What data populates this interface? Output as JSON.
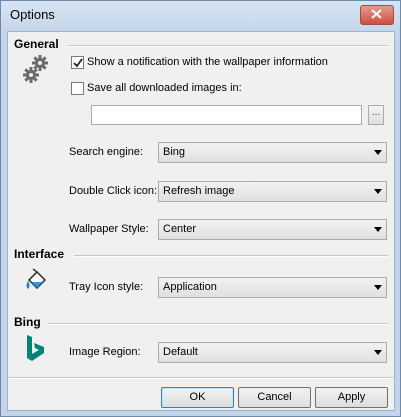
{
  "window": {
    "title": "Options"
  },
  "general": {
    "title": "General",
    "show_notification": {
      "label": "Show a notification with the wallpaper information",
      "checked": true
    },
    "save_images": {
      "label": "Save all downloaded images in:",
      "checked": false
    },
    "save_path": {
      "value": ""
    },
    "browse_label": "...",
    "search_engine": {
      "label": "Search engine:",
      "value": "Bing"
    },
    "double_click": {
      "label": "Double Click icon:",
      "value": "Refresh image"
    },
    "wallpaper_style": {
      "label": "Wallpaper Style:",
      "value": "Center"
    }
  },
  "interface": {
    "title": "Interface",
    "tray_icon_style": {
      "label": "Tray Icon style:",
      "value": "Application"
    }
  },
  "bing": {
    "title": "Bing",
    "image_region": {
      "label": "Image Region:",
      "value": "Default"
    }
  },
  "buttons": {
    "ok": "OK",
    "cancel": "Cancel",
    "apply": "Apply"
  },
  "icons": {
    "settings": "gears-icon",
    "interface": "paint-bucket-icon",
    "bing": "bing-logo-icon",
    "close": "close-icon"
  },
  "colors": {
    "bing_logo": "#008373",
    "close_button": "#c9503f"
  }
}
